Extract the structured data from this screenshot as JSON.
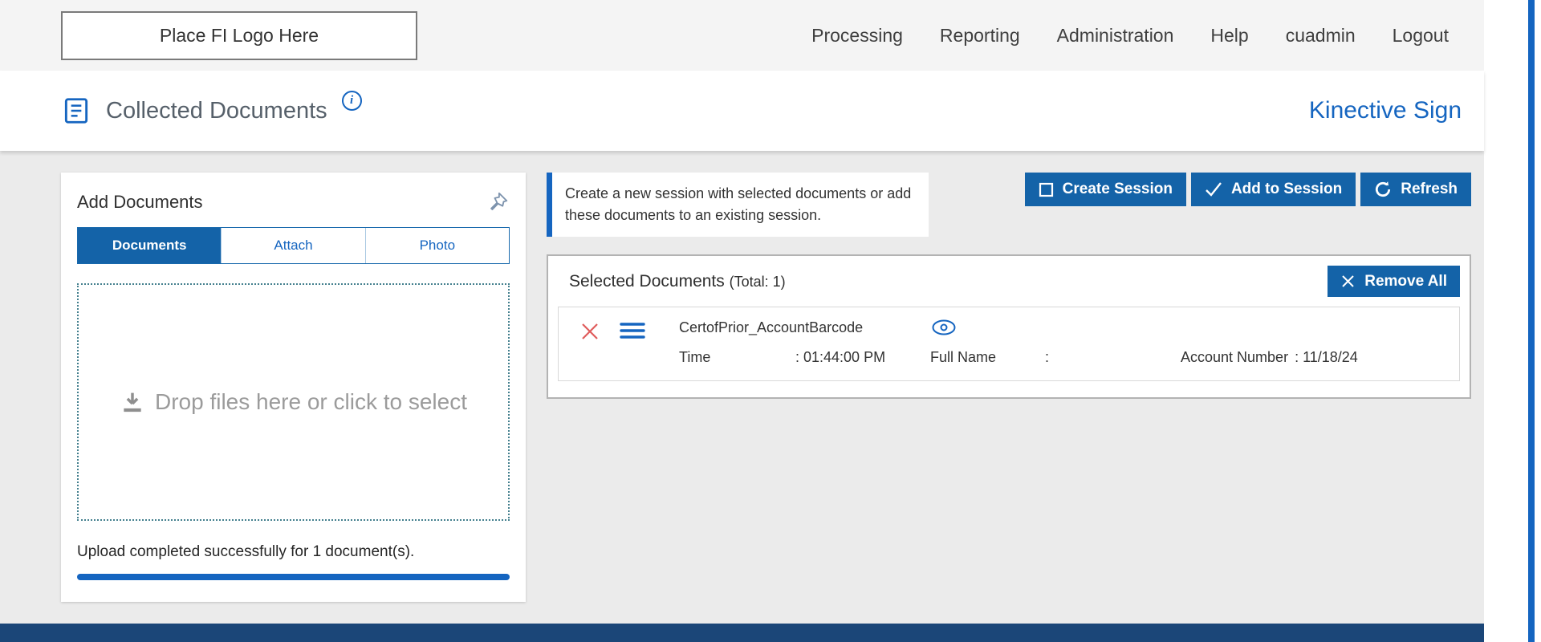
{
  "header": {
    "logo_text": "Place FI Logo Here",
    "nav": [
      {
        "label": "Processing"
      },
      {
        "label": "Reporting"
      },
      {
        "label": "Administration"
      },
      {
        "label": "Help"
      },
      {
        "label": "cuadmin"
      },
      {
        "label": "Logout"
      }
    ]
  },
  "subheader": {
    "title": "Collected Documents",
    "info_icon_glyph": "i",
    "brand": "Kinective Sign"
  },
  "add_documents": {
    "title": "Add Documents",
    "tabs": [
      {
        "label": "Documents",
        "active": true
      },
      {
        "label": "Attach",
        "active": false
      },
      {
        "label": "Photo",
        "active": false
      }
    ],
    "dropzone_text": "Drop files here or click to select",
    "upload_status": "Upload completed successfully for 1 document(s).",
    "progress_percent": 100
  },
  "session": {
    "info_text": "Create a new session with selected documents or add these documents to an existing session.",
    "buttons": {
      "create": "Create Session",
      "add": "Add to Session",
      "refresh": "Refresh"
    }
  },
  "selected_documents": {
    "title": "Selected Documents",
    "total_text": "(Total: 1)",
    "remove_all_label": "Remove All",
    "rows": [
      {
        "file_name": "CertofPrior_AccountBarcode",
        "time_label": "Time",
        "time_value": ": 01:44:00 PM",
        "fullname_label": "Full Name",
        "fullname_value": ":",
        "account_label": "Account Number",
        "account_value": ": 11/18/24"
      }
    ]
  },
  "icons": {
    "title_icon": "document-lines-icon",
    "info": "info-icon",
    "pin": "pushpin-icon",
    "dropzone": "download-icon",
    "create_session": "square-icon",
    "add_to_session": "check-icon",
    "refresh": "refresh-icon",
    "remove_all": "close-icon",
    "row_delete": "red-close-icon",
    "row_drag": "hamburger-icon",
    "row_preview": "eye-icon"
  },
  "colors": {
    "accent_blue": "#1463a8",
    "link_blue": "#1565c0",
    "footer_blue": "#1b4678",
    "danger_red": "#e05c5c",
    "dropzone_border": "#44808e",
    "content_bg": "#ebebeb",
    "topbar_bg": "#f4f4f4"
  }
}
